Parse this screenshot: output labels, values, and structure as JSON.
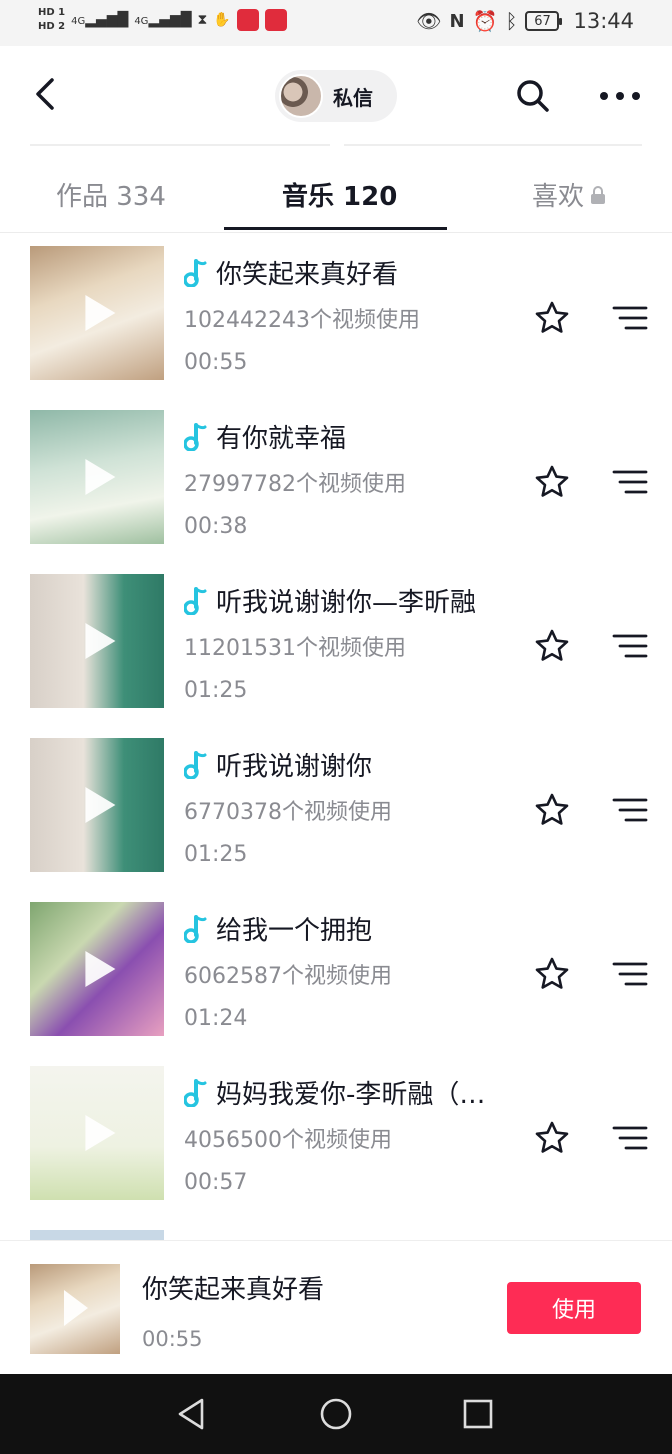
{
  "status_bar": {
    "hd_top": "HD 1",
    "hd_bottom": "HD 2",
    "net1": "4G",
    "net2": "4G",
    "battery": "67",
    "time": "13:44"
  },
  "header": {
    "dm_label": "私信"
  },
  "tabs": [
    {
      "label": "作品 334"
    },
    {
      "label": "音乐 120"
    },
    {
      "label": "喜欢"
    }
  ],
  "music": [
    {
      "title": "你笑起来真好看",
      "usage": "102442243个视频使用",
      "duration": "00:55"
    },
    {
      "title": "有你就幸福",
      "usage": "27997782个视频使用",
      "duration": "00:38"
    },
    {
      "title": "听我说谢谢你—李昕融",
      "usage": "11201531个视频使用",
      "duration": "01:25"
    },
    {
      "title": "听我说谢谢你",
      "usage": "6770378个视频使用",
      "duration": "01:25"
    },
    {
      "title": "给我一个拥抱",
      "usage": "6062587个视频使用",
      "duration": "01:24"
    },
    {
      "title": "妈妈我爱你-李昕融（…",
      "usage": "4056500个视频使用",
      "duration": "00:57"
    }
  ],
  "player": {
    "title": "你笑起来真好看",
    "time": "00:55",
    "use_label": "使用"
  },
  "colors": {
    "accent": "#fe2c55",
    "note": "#25c4e0",
    "text_primary": "#161823",
    "text_secondary": "#8a8b91"
  }
}
